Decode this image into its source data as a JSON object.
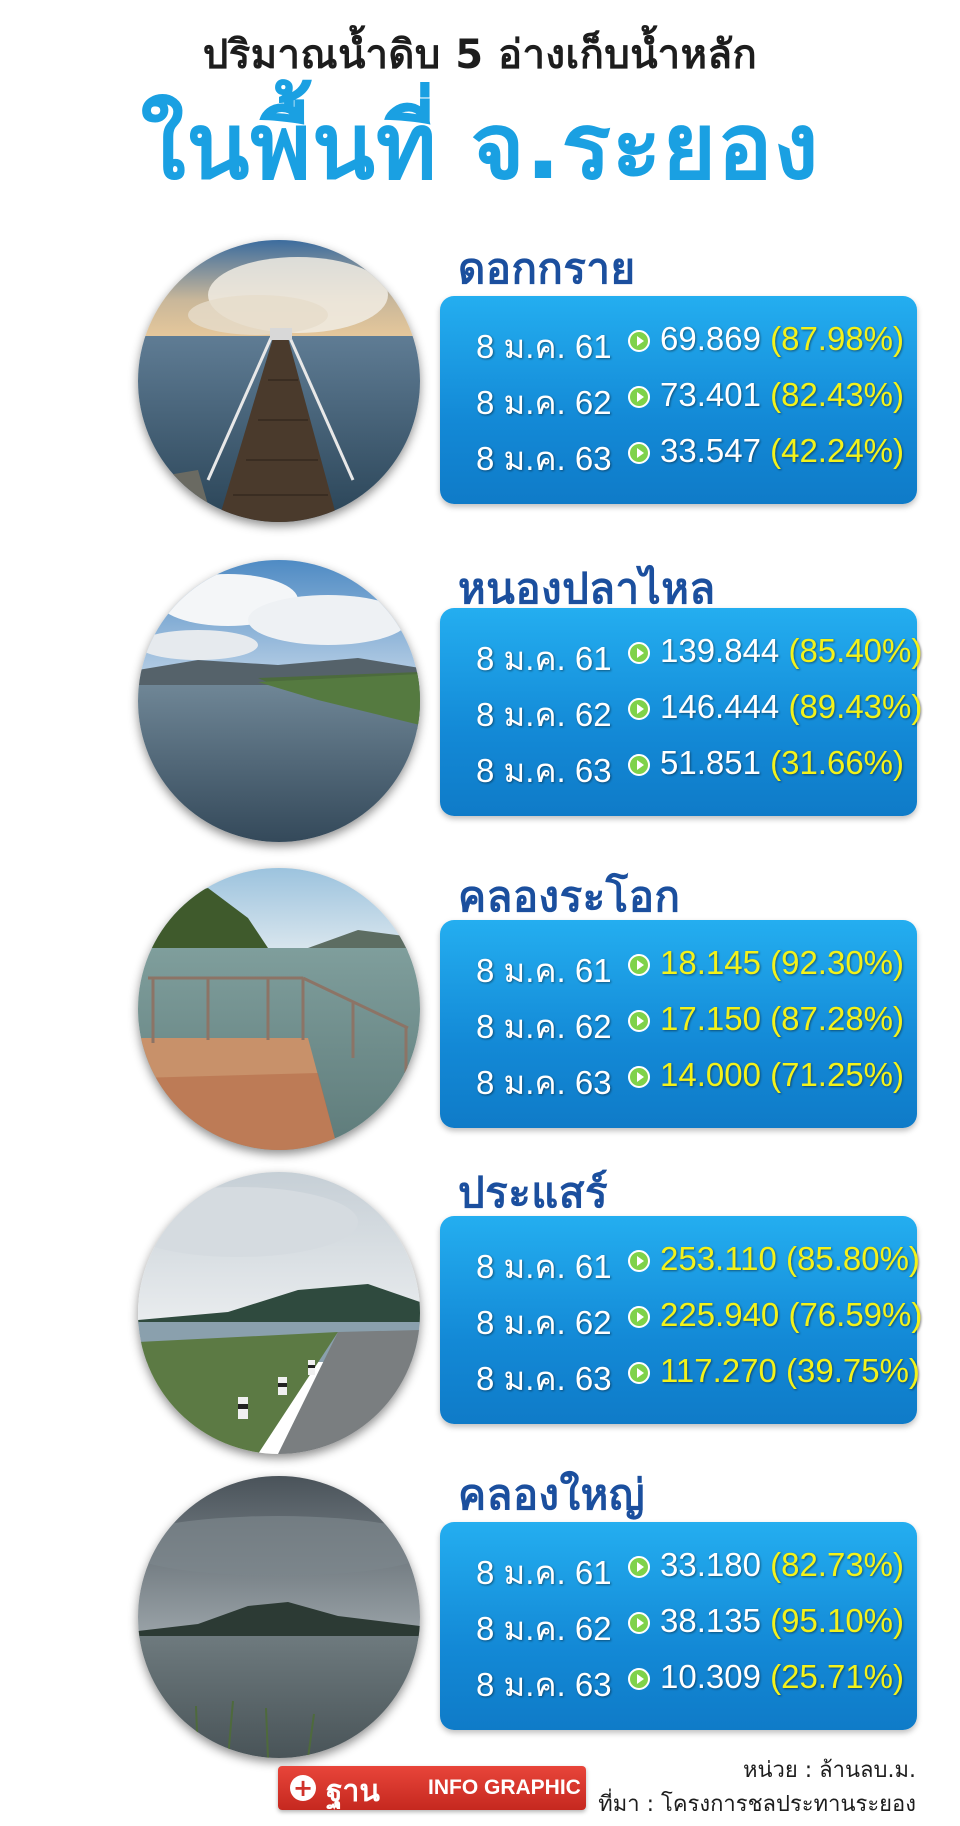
{
  "header": {
    "title_line1": "ปริมาณน้ำดิบ 5 อ่างเก็บน้ำหลัก",
    "title_line2": "ในพื้นที่ จ.ระยอง"
  },
  "colors": {
    "title_blue": "#1aa0e2",
    "name_blue": "#1b4f9e",
    "panel_blue": "#1389d6",
    "highlight_yellow": "#f3f21a",
    "arrow_green": "#7fd24a",
    "logo_red": "#d0322a"
  },
  "reservoirs": [
    {
      "name": "ดอกกราย",
      "photo_icon": "pier-lake-photo",
      "rows": [
        {
          "date": "8 ม.ค. 61",
          "value": "69.869",
          "percent": "(87.98%)"
        },
        {
          "date": "8 ม.ค. 62",
          "value": "73.401",
          "percent": "(82.43%)"
        },
        {
          "date": "8 ม.ค. 63",
          "value": "33.547",
          "percent": "(42.24%)"
        }
      ]
    },
    {
      "name": "หนองปลาไหล",
      "photo_icon": "reservoir-landscape-photo",
      "rows": [
        {
          "date": "8 ม.ค. 61",
          "value": "139.844",
          "percent": "(85.40%)"
        },
        {
          "date": "8 ม.ค. 62",
          "value": "146.444",
          "percent": "(89.43%)"
        },
        {
          "date": "8 ม.ค. 63",
          "value": "51.851",
          "percent": "(31.66%)"
        }
      ]
    },
    {
      "name": "คลองระโอก",
      "photo_icon": "concrete-platform-photo",
      "rows": [
        {
          "date": "8 ม.ค. 61",
          "value": "18.145",
          "percent": "(92.30%)"
        },
        {
          "date": "8 ม.ค. 62",
          "value": "17.150",
          "percent": "(87.28%)"
        },
        {
          "date": "8 ม.ค. 63",
          "value": "14.000",
          "percent": "(71.25%)"
        }
      ]
    },
    {
      "name": "ประแสร์",
      "photo_icon": "dam-road-photo",
      "rows": [
        {
          "date": "8 ม.ค. 61",
          "value": "253.110",
          "percent": "(85.80%)"
        },
        {
          "date": "8 ม.ค. 62",
          "value": "225.940",
          "percent": "(76.59%)"
        },
        {
          "date": "8 ม.ค. 63",
          "value": "117.270",
          "percent": "(39.75%)"
        }
      ]
    },
    {
      "name": "คลองใหญ่",
      "photo_icon": "cloudy-lake-photo",
      "rows": [
        {
          "date": "8 ม.ค. 61",
          "value": "33.180",
          "percent": "(82.73%)"
        },
        {
          "date": "8 ม.ค. 62",
          "value": "38.135",
          "percent": "(95.10%)"
        },
        {
          "date": "8 ม.ค. 63",
          "value": "10.309",
          "percent": "(25.71%)"
        }
      ]
    }
  ],
  "footer": {
    "logo_brand": "ฐาน",
    "logo_suffix": "INFO GRAPHIC",
    "unit": "หน่วย : ล้านลบ.ม.",
    "source": "ที่มา : โครงการชลประทานระยอง"
  }
}
